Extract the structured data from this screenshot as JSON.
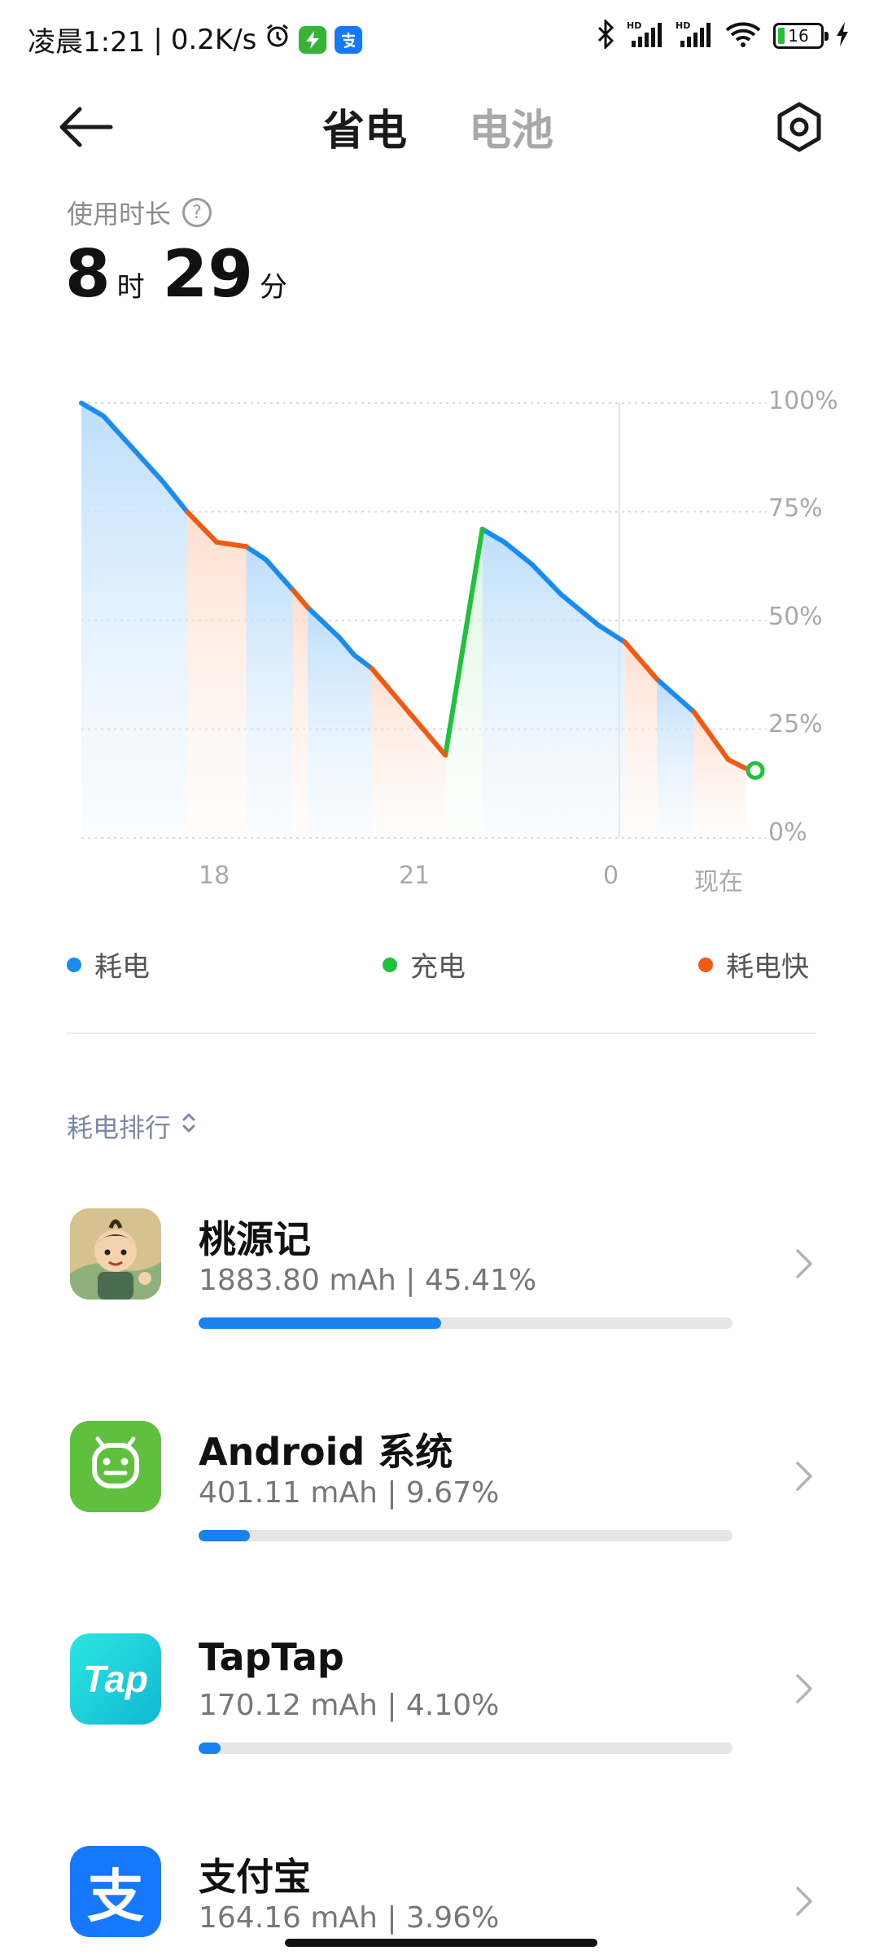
{
  "status_bar": {
    "time": "凌晨1:21",
    "network_speed": "0.2K/s",
    "separator": "|",
    "alarm_icon": "alarm-icon",
    "battery_level": "16"
  },
  "header": {
    "back_icon": "arrow-left-icon",
    "tab_power_saving": "省电",
    "tab_battery": "电池",
    "settings_icon": "settings-icon"
  },
  "usage": {
    "label": "使用时长",
    "hours": "8",
    "hours_unit": "时",
    "minutes": "29",
    "minutes_unit": "分"
  },
  "chart_data": {
    "type": "line",
    "y_ticks": [
      "100%",
      "75%",
      "50%",
      "25%",
      "0%"
    ],
    "x_ticks": [
      "18",
      "21",
      "0",
      "现在"
    ],
    "ylim": [
      0,
      100
    ],
    "series": [
      {
        "name": "耗电",
        "color": "#1a8cf0",
        "segments": [
          [
            [
              0,
              100
            ],
            [
              0.9,
              97
            ],
            [
              1.7,
              92
            ],
            [
              2.5,
              87
            ],
            [
              3.3,
              82
            ],
            [
              4.3,
              75
            ]
          ],
          [
            [
              6.7,
              67
            ],
            [
              7.5,
              64
            ],
            [
              8.6,
              57
            ]
          ],
          [
            [
              9.2,
              53
            ],
            [
              10.5,
              46
            ],
            [
              11.1,
              42
            ],
            [
              11.8,
              39
            ]
          ],
          [
            [
              16.3,
              71
            ],
            [
              17.2,
              68
            ],
            [
              18.3,
              63
            ],
            [
              19.5,
              56
            ],
            [
              21,
              49
            ],
            [
              22.1,
              45
            ]
          ],
          [
            [
              23.4,
              36.5
            ],
            [
              24.9,
              29
            ]
          ]
        ]
      },
      {
        "name": "充电",
        "color": "#1fc23a",
        "segments": [
          [
            [
              14.8,
              19
            ],
            [
              16.3,
              71
            ]
          ]
        ]
      },
      {
        "name": "耗电快",
        "color": "#f05a12",
        "segments": [
          [
            [
              4.3,
              75
            ],
            [
              5.5,
              68
            ],
            [
              6.7,
              67
            ]
          ],
          [
            [
              8.6,
              57
            ],
            [
              9.2,
              53
            ]
          ],
          [
            [
              11.8,
              39
            ],
            [
              13.3,
              29
            ],
            [
              14.8,
              19
            ]
          ],
          [
            [
              22.1,
              45
            ],
            [
              23.4,
              36.5
            ]
          ],
          [
            [
              24.9,
              29
            ],
            [
              26.3,
              18
            ],
            [
              27,
              16
            ]
          ]
        ]
      }
    ],
    "current_value": 15.5,
    "x_max": 27.4
  },
  "legend": {
    "drain": "耗电",
    "charge": "充电",
    "fast_drain": "耗电快"
  },
  "ranking": {
    "title": "耗电排行",
    "sort_icon": "sort-updown-icon"
  },
  "apps": [
    {
      "name": "桃源记",
      "stats": "1883.80 mAh | 45.41%",
      "percent": 45.41
    },
    {
      "name": "Android 系统",
      "stats": "401.11 mAh | 9.67%",
      "percent": 9.67
    },
    {
      "name": "TapTap",
      "stats": "170.12 mAh | 4.10%",
      "percent": 4.1
    },
    {
      "name": "支付宝",
      "stats": "164.16 mAh | 3.96%",
      "percent": 3.96
    }
  ],
  "app_icons": {
    "tap_text": "Tap",
    "alipay_text": "支"
  }
}
